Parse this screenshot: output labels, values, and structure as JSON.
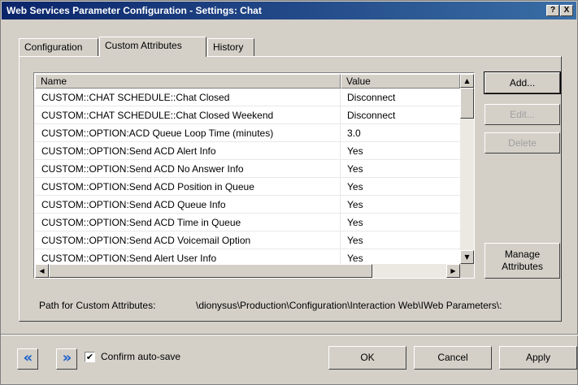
{
  "window": {
    "title": "Web Services Parameter Configuration - Settings: Chat",
    "help_glyph": "?",
    "close_glyph": "X"
  },
  "tabs": [
    {
      "label": "Configuration",
      "active": false
    },
    {
      "label": "Custom Attributes",
      "active": true
    },
    {
      "label": "History",
      "active": false
    }
  ],
  "table": {
    "columns": [
      "Name",
      "Value"
    ],
    "rows": [
      {
        "name": "CUSTOM::CHAT SCHEDULE::Chat Closed",
        "value": "Disconnect"
      },
      {
        "name": "CUSTOM::CHAT SCHEDULE::Chat Closed Weekend",
        "value": "Disconnect"
      },
      {
        "name": "CUSTOM::OPTION:ACD Queue Loop Time (minutes)",
        "value": "3.0"
      },
      {
        "name": "CUSTOM::OPTION:Send ACD Alert Info",
        "value": "Yes"
      },
      {
        "name": "CUSTOM::OPTION:Send ACD No Answer Info",
        "value": "Yes"
      },
      {
        "name": "CUSTOM::OPTION:Send ACD Position in Queue",
        "value": "Yes"
      },
      {
        "name": "CUSTOM::OPTION:Send ACD Queue Info",
        "value": "Yes"
      },
      {
        "name": "CUSTOM::OPTION:Send ACD Time in Queue",
        "value": "Yes"
      },
      {
        "name": "CUSTOM::OPTION:Send ACD Voicemail Option",
        "value": "Yes"
      },
      {
        "name": "CUSTOM::OPTION:Send Alert User Info",
        "value": "Yes"
      }
    ]
  },
  "buttons": {
    "add": "Add...",
    "edit": "Edit...",
    "delete": "Delete",
    "manage_line1": "Manage",
    "manage_line2": "Attributes",
    "ok": "OK",
    "cancel": "Cancel",
    "apply": "Apply"
  },
  "path": {
    "label": "Path for Custom Attributes:",
    "value": "\\dionysus\\Production\\Configuration\\Interaction Web\\IWeb Parameters\\:"
  },
  "footer": {
    "confirm_label": "Confirm auto-save",
    "confirm_checked": true,
    "check_glyph": "✔",
    "prev_glyph": "«",
    "next_glyph": "»"
  },
  "scrollbar_glyphs": {
    "up": "▲",
    "down": "▼",
    "left": "◀",
    "right": "▶"
  },
  "colors": {
    "titlebar_start": "#0a246a",
    "titlebar_end": "#3a6ea5",
    "face": "#d4d0c8",
    "nav_arrow": "#1a5fcf",
    "disabled_text": "#a0a0a0"
  }
}
